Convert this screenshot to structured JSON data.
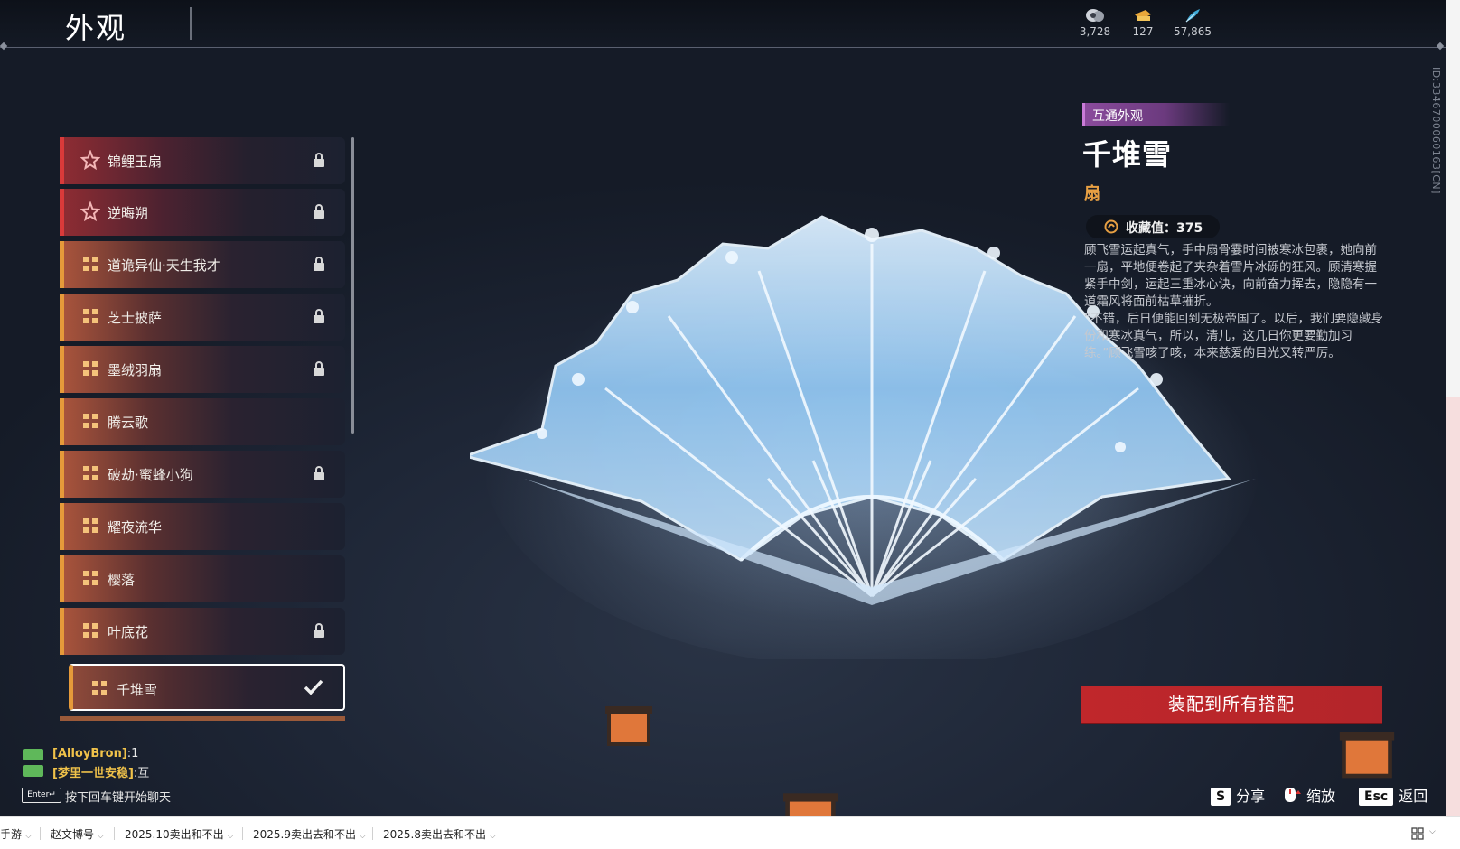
{
  "header": {
    "title": "外观",
    "currencies": [
      {
        "icon": "coin-icon",
        "value": "3,728"
      },
      {
        "icon": "ticket-icon",
        "value": "127"
      },
      {
        "icon": "feather-icon",
        "value": "57,865"
      }
    ]
  },
  "vertical_id": "ID:3346700060163[CN]",
  "list": {
    "items": [
      {
        "name": "锦鲤玉扇",
        "rarity": "red",
        "status": "locked"
      },
      {
        "name": "逆晦朔",
        "rarity": "red",
        "status": "locked"
      },
      {
        "name": "道诡异仙·天生我才",
        "rarity": "orange",
        "status": "locked"
      },
      {
        "name": "芝士披萨",
        "rarity": "orange",
        "status": "locked"
      },
      {
        "name": "墨绒羽扇",
        "rarity": "orange",
        "status": "locked"
      },
      {
        "name": "腾云歌",
        "rarity": "orange",
        "status": "owned"
      },
      {
        "name": "破劫·蜜蜂小狗",
        "rarity": "orange",
        "status": "locked"
      },
      {
        "name": "耀夜流华",
        "rarity": "orange",
        "status": "owned"
      },
      {
        "name": "樱落",
        "rarity": "orange",
        "status": "owned"
      },
      {
        "name": "叶底花",
        "rarity": "orange",
        "status": "locked"
      },
      {
        "name": "千堆雪",
        "rarity": "orange",
        "status": "equipped"
      }
    ]
  },
  "detail": {
    "tag": "互通外观",
    "name": "千堆雪",
    "type": "扇",
    "collection_label": "收藏值：375",
    "description": "顾飞雪运起真气，手中扇骨霎时间被寒冰包裹，她向前一扇，平地便卷起了夹杂着雪片冰砾的狂风。顾清寒握紧手中剑，运起三重冰心诀，向前奋力挥去，隐隐有一道霜风将面前枯草摧折。\n“不错，后日便能回到无极帝国了。以后，我们要隐藏身份和寒冰真气，所以，清儿，这几日你更要勤加习练。”顾飞雪咳了咳，本来慈爱的目光又转严厉。",
    "equip_button": "装配到所有搭配"
  },
  "chat": {
    "lines": [
      {
        "name": "[AlloyBron]",
        "msg": ":1"
      },
      {
        "name": "[梦里一世安稳]",
        "msg": ":互"
      }
    ],
    "enter_key": "Enter↵",
    "enter_hint": "按下回车键开始聊天"
  },
  "controls": [
    {
      "key": "S",
      "label": "分享"
    },
    {
      "key": "",
      "icon": "mouse-icon",
      "label": "缩放"
    },
    {
      "key": "Esc",
      "label": "返回"
    }
  ],
  "taskbar": {
    "items": [
      "手游",
      "赵文博号",
      "2025.10卖出和不出",
      "2025.9卖出去和不出",
      "2025.8卖出去和不出"
    ],
    "right_icon": "grid-icon"
  },
  "colors": {
    "red_rarity": "#d93a3a",
    "orange_rarity": "#e69a3a",
    "tag_purple": "#8a4b9c",
    "equip_red": "#c0272b",
    "type_gold": "#e8a043"
  }
}
